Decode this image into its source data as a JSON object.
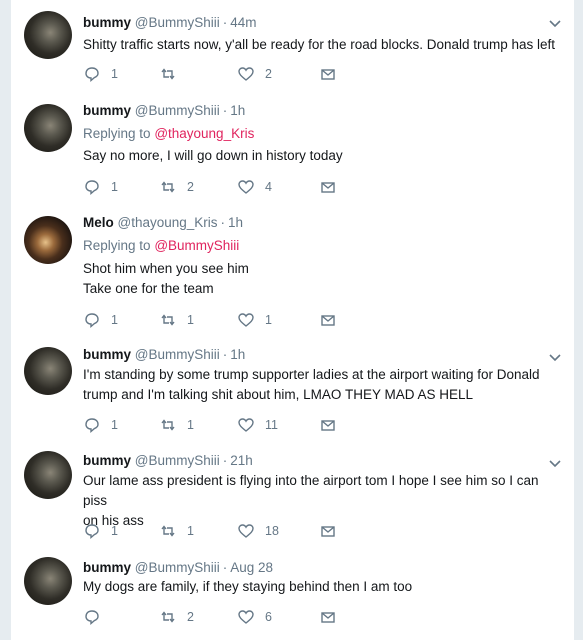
{
  "tweets": [
    {
      "name": "bummy",
      "handle": "@BummyShiii",
      "time": "44m",
      "reply_to": "",
      "text": [
        "Shitty traffic starts now, y'all be ready for the road blocks. Donald trump has left"
      ],
      "replies": "1",
      "retweets": "",
      "likes": "2",
      "avatar": "b"
    },
    {
      "name": "bummy",
      "handle": "@BummyShiii",
      "time": "1h",
      "reply_to": "@thayoung_Kris",
      "text": [
        "Say no more, I will go down in history today"
      ],
      "replies": "1",
      "retweets": "2",
      "likes": "4",
      "avatar": "b"
    },
    {
      "name": "Melo",
      "handle": "@thayoung_Kris",
      "time": "1h",
      "reply_to": "@BummyShiii",
      "text": [
        "Shot him when you see him",
        "Take one for the team"
      ],
      "replies": "1",
      "retweets": "1",
      "likes": "1",
      "avatar": "m"
    },
    {
      "name": "bummy",
      "handle": "@BummyShiii",
      "time": "1h",
      "reply_to": "",
      "text": [
        "I'm standing by some trump supporter ladies at the airport waiting for Donald",
        "trump and I'm talking shit about him, LMAO THEY MAD AS HELL"
      ],
      "replies": "1",
      "retweets": "1",
      "likes": "11",
      "avatar": "b"
    },
    {
      "name": "bummy",
      "handle": "@BummyShiii",
      "time": "21h",
      "reply_to": "",
      "text": [
        "Our lame ass president is flying into the airport tom I hope I see him so I can piss",
        "on his ass"
      ],
      "replies": "1",
      "retweets": "1",
      "likes": "18",
      "avatar": "b"
    },
    {
      "name": "bummy",
      "handle": "@BummyShiii",
      "time": "Aug 28",
      "reply_to": "",
      "text": [
        "My dogs are family, if they staying behind then I am too"
      ],
      "replies": "",
      "retweets": "2",
      "likes": "6",
      "avatar": "b"
    }
  ],
  "labels": {
    "replying_to": "Replying to",
    "separator": "·"
  },
  "icons": {
    "reply": "reply-icon",
    "retweet": "retweet-icon",
    "like": "heart-icon",
    "message": "envelope-icon",
    "menu": "chevron-down-icon"
  },
  "colors": {
    "mention": "#e0245e",
    "muted": "#657786",
    "text": "#14171a",
    "divider": "#e6ecf0"
  }
}
